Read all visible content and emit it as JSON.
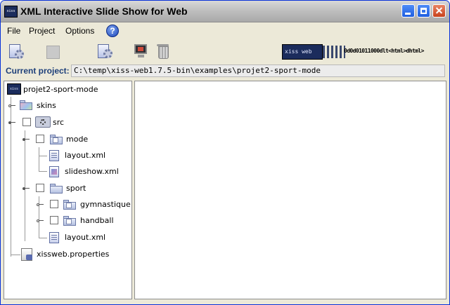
{
  "window": {
    "title": "XML Interactive Slide Show for Web",
    "app_icon_text": "xiss",
    "icon": "xiss-app-icon"
  },
  "menu": {
    "file": "File",
    "project": "Project",
    "options": "Options",
    "help_icon": "help-icon",
    "help_glyph": "?"
  },
  "toolbar": {
    "buttons": [
      {
        "icon": "new-project-icon"
      },
      {
        "icon": "save-project-icon-disabled"
      },
      {
        "icon": "settings-icon"
      },
      {
        "icon": "preview-monitor-icon"
      },
      {
        "icon": "trash-icon"
      }
    ],
    "banner_logo": "xiss web",
    "banner_code": "0d0d01011000dlt<html>dhtml>"
  },
  "project": {
    "label": "Current project:",
    "path": "C:\\temp\\xiss-web1.7.5-bin\\examples\\projet2-sport-mode"
  },
  "tree": {
    "root": {
      "label": "projet2-sport-mode",
      "icon_text": "xiss"
    },
    "skins": "skins",
    "src": "src",
    "mode": "mode",
    "mode_layout": "layout.xml",
    "mode_slideshow": "slideshow.xml",
    "sport": "sport",
    "gymnastique": "gymnastique",
    "handball": "handball",
    "sport_layout": "layout.xml",
    "properties": "xissweb.properties"
  },
  "colors": {
    "title_bar": "#bdbdbd",
    "window_bg": "#ece9d8",
    "project_label": "#1d3f7a",
    "close_button": "#c8411b"
  }
}
